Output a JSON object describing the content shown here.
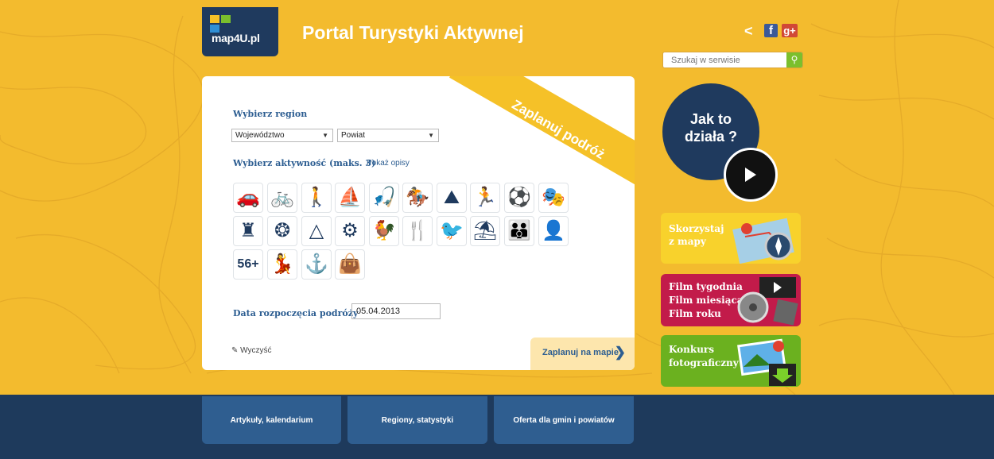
{
  "header": {
    "logo_text": "map4U.pl",
    "title": "Portal Turystyki Aktywnej",
    "social": [
      "share",
      "facebook",
      "google-plus"
    ],
    "fb_glyph": "f",
    "gp_glyph": "g+"
  },
  "search": {
    "placeholder": "Szukaj w serwisie"
  },
  "planner": {
    "ribbon": "Zaplanuj podróż",
    "region_label": "Wybierz region",
    "voivodeship": "Województwo",
    "county": "Powiat",
    "activity_label": "Wybierz aktywność (maks. 3)",
    "show_descriptions": "Pokaż opisy",
    "activities": [
      "car-icon",
      "bicycle-icon",
      "hiking-icon",
      "sailing-icon",
      "fishing-icon",
      "horse-riding-icon",
      "mountains-icon",
      "running-icon",
      "football-icon",
      "theatre-masks-icon",
      "knight-helmet-icon",
      "cannon-icon",
      "eye-triangle-icon",
      "gears-icon",
      "rooster-icon",
      "cutlery-icon",
      "bird-icon",
      "deckchair-icon",
      "family-icon",
      "portrait-icon",
      "56+",
      "dancer-icon",
      "monk-icon",
      "shopping-bag-icon"
    ],
    "start_date_label": "Data rozpoczęcia podróży",
    "start_date": "05.04.2013",
    "clear_label": "Wyczyść",
    "plan_button": "Zaplanuj na mapie"
  },
  "sidebar": {
    "how_it_works": [
      "Jak to",
      "działa ?"
    ],
    "tile_map": [
      "Skorzystaj",
      "z mapy"
    ],
    "tile_film": [
      "Film tygodnia",
      "Film miesiąca",
      "Film roku"
    ],
    "tile_photo": [
      "Konkurs",
      "fotograficzny"
    ]
  },
  "footer_tabs": [
    "Artykuły, kalendarium",
    "Regiony, statystyki",
    "Oferta dla gmin i powiatów"
  ]
}
